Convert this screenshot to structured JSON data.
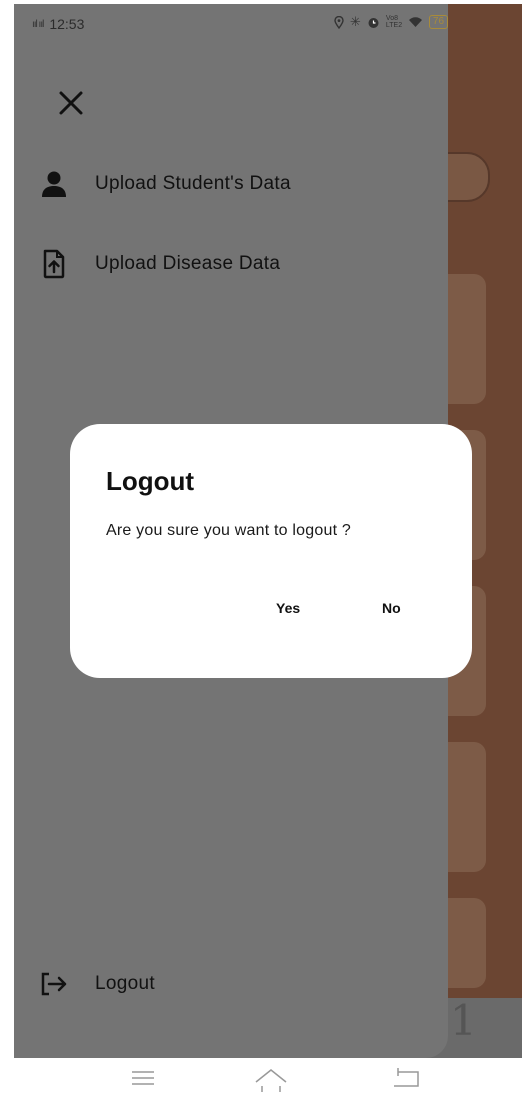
{
  "status_bar": {
    "signal": "ııl ııl",
    "time": "12:53",
    "icons": [
      "location-icon",
      "bluetooth-icon",
      "alarm-icon",
      "volte-icon",
      "wifi-icon"
    ],
    "volte_text": "Vo8 LTE2",
    "battery": "76"
  },
  "drawer": {
    "items": [
      {
        "label": "Upload Student's Data",
        "icon": "person-icon"
      },
      {
        "label": "Upload Disease Data",
        "icon": "file-upload-icon"
      }
    ],
    "logout_label": "Logout"
  },
  "dialog": {
    "title": "Logout",
    "message": "Are you sure you want to logout ?",
    "yes_label": "Yes",
    "no_label": "No"
  },
  "colors": {
    "drawer_bg": "#747474",
    "backdrop": "#6b4532",
    "dialog_bg": "#ffffff"
  }
}
